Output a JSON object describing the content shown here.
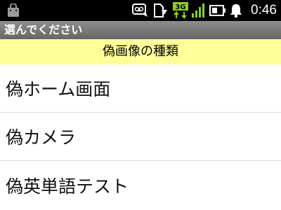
{
  "status_bar": {
    "time": "0:46",
    "network": "3G",
    "icons": [
      "shopping-bag-icon",
      "voicemail-icon",
      "download-icon",
      "network-3g-icon",
      "signal-icon",
      "battery-icon",
      "notification-bell-icon"
    ]
  },
  "title_bar": {
    "title": "選んでください"
  },
  "header": {
    "label": "偽画像の種類"
  },
  "list": {
    "items": [
      {
        "label": "偽ホーム画面"
      },
      {
        "label": "偽カメラ"
      },
      {
        "label": "偽英単語テスト"
      }
    ]
  },
  "colors": {
    "header_background": "#ffff99",
    "status_bar_background": "#000000",
    "title_bar_background": "#777777",
    "icon_green": "#8dd11e"
  }
}
